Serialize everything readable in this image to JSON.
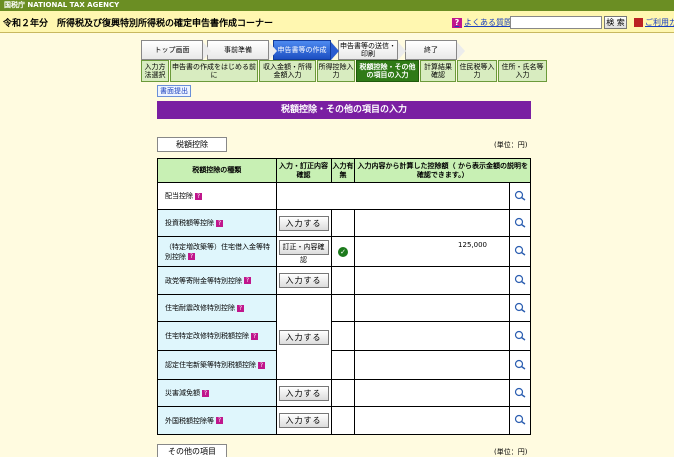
{
  "header": {
    "agency": "国税庁 NATIONAL TAX AGENCY",
    "title": "令和２年分　所得税及び復興特別所得税の確定申告書作成コーナー",
    "faq_label": "よくある質問",
    "search_placeholder": "",
    "search_button": "検 索",
    "guide_label": "ご利用ガ"
  },
  "steps": [
    {
      "label": "トップ画面"
    },
    {
      "label": "事前準備"
    },
    {
      "label": "申告書等の作成"
    },
    {
      "label": "申告書等の送信・印刷"
    },
    {
      "label": "終了"
    }
  ],
  "substeps": [
    {
      "label": "入力方法選択"
    },
    {
      "label": "申告書の作成をはじめる前に"
    },
    {
      "label": "収入金額・所得金額入力"
    },
    {
      "label": "所得控除入力"
    },
    {
      "label": "税額控除・その他の項目の入力"
    },
    {
      "label": "計算結果確認"
    },
    {
      "label": "住民税等入力"
    },
    {
      "label": "住所・氏名等入力"
    }
  ],
  "doc_button": "書面提出",
  "section_title": "税額控除・その他の項目の入力",
  "deduction_tab": "税額控除",
  "unit_label": "(単位：円)",
  "table": {
    "headers": {
      "type": "税額控除の種類",
      "action": "入力・訂正内容確認",
      "has_input": "入力有無",
      "amount": "入力内容から計算した控除額（ から表示金額の説明を確認できます。）"
    },
    "rows": [
      {
        "name": "配当控除",
        "button": "",
        "check": "",
        "amount": ""
      },
      {
        "name": "投資税額等控除",
        "button": "入力する",
        "check": "",
        "amount": ""
      },
      {
        "name": "（特定増改築等）住宅借入金等特別控除",
        "button": "訂正・内容確認",
        "check": "✓",
        "amount": "125,000"
      },
      {
        "name": "政党等寄附金等特別控除",
        "button": "入力する",
        "check": "",
        "amount": ""
      },
      {
        "name": "住宅耐震改修特別控除",
        "button": "",
        "check": "",
        "amount": ""
      },
      {
        "name": "住宅特定改修特別税額控除",
        "button": "入力する",
        "check": "",
        "amount": ""
      },
      {
        "name": "認定住宅新築等特別税額控除",
        "button": "",
        "check": "",
        "amount": ""
      },
      {
        "name": "災害減免額",
        "button": "入力する",
        "check": "",
        "amount": ""
      },
      {
        "name": "外国税額控除等",
        "button": "入力する",
        "check": "",
        "amount": ""
      }
    ]
  },
  "other_tab": "その他の項目",
  "other_unit_label": "(単位：円)"
}
